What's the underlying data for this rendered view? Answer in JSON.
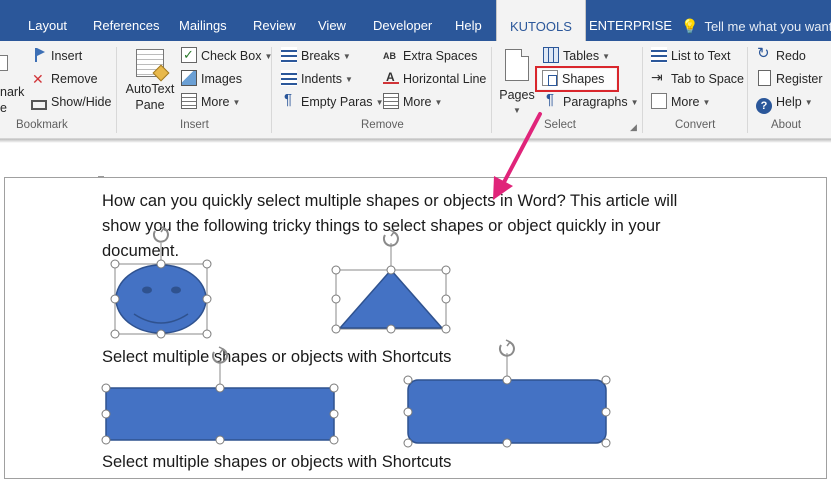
{
  "tabs": [
    {
      "id": "layout",
      "label": "Layout"
    },
    {
      "id": "references",
      "label": "References"
    },
    {
      "id": "mailings",
      "label": "Mailings"
    },
    {
      "id": "review",
      "label": "Review"
    },
    {
      "id": "view",
      "label": "View"
    },
    {
      "id": "developer",
      "label": "Developer"
    },
    {
      "id": "help",
      "label": "Help"
    },
    {
      "id": "kutools",
      "label": "KUTOOLS",
      "active": true
    },
    {
      "id": "enterprise",
      "label": "ENTERPRISE"
    }
  ],
  "tell_me": {
    "placeholder": "Tell me what you want to",
    "icon": "lightbulb-icon"
  },
  "ribbon": {
    "bookmark": {
      "partial_big_label_1": "nark",
      "partial_big_label_2": "e",
      "insert": "Insert",
      "remove": "Remove",
      "show_hide": "Show/Hide",
      "label": "Bookmark"
    },
    "insert": {
      "autotext_line1": "AutoText",
      "autotext_line2": "Pane",
      "check_box": "Check Box",
      "images": "Images",
      "more": "More",
      "label": "Insert"
    },
    "remove": {
      "breaks": "Breaks",
      "indents": "Indents",
      "empty_paras": "Empty Paras",
      "extra_spaces": "Extra Spaces",
      "horizontal_line": "Horizontal Line",
      "more": "More",
      "label": "Remove"
    },
    "select": {
      "pages": "Pages",
      "tables": "Tables",
      "shapes": "Shapes",
      "paragraphs": "Paragraphs",
      "label": "Select"
    },
    "convert": {
      "list_to_text": "List to Text",
      "tab_to_space": "Tab to Space",
      "more": "More",
      "label": "Convert"
    },
    "about": {
      "redo": "Redo",
      "register": "Register",
      "help": "Help",
      "label": "About"
    }
  },
  "document": {
    "paragraph_line1": "How can you quickly select multiple shapes or objects in Word? This article will",
    "paragraph_line2": "show you the following tricky things to select shapes or object quickly in your",
    "paragraph_line3": "document.",
    "heading1": "Select multiple shapes or objects with Shortcuts",
    "heading2": "Select multiple shapes or objects with Shortcuts"
  },
  "colors": {
    "tab_bar": "#2b579a",
    "ribbon_bg": "#f3f3f3",
    "shape_fill": "#4472c4",
    "shape_stroke": "#2f528f",
    "highlight_box": "#d9262c",
    "annotation_arrow": "#e0247a"
  }
}
